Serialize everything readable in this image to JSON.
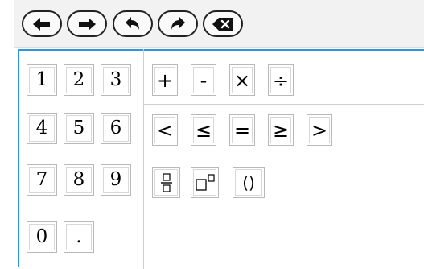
{
  "toolbar": {
    "buttons": [
      {
        "name": "back-button",
        "icon": "arrow-left-icon"
      },
      {
        "name": "forward-button",
        "icon": "arrow-right-icon"
      },
      {
        "name": "undo-button",
        "icon": "undo-icon"
      },
      {
        "name": "redo-button",
        "icon": "redo-icon"
      },
      {
        "name": "backspace-button",
        "icon": "backspace-icon"
      }
    ]
  },
  "keypad": {
    "digits": {
      "row1": [
        "1",
        "2",
        "3"
      ],
      "row2": [
        "4",
        "5",
        "6"
      ],
      "row3": [
        "7",
        "8",
        "9"
      ],
      "row4": [
        "0",
        "."
      ]
    },
    "operators": [
      "+",
      "-",
      "×",
      "÷"
    ],
    "comparisons": [
      "<",
      "≤",
      "=",
      "≥",
      ">"
    ],
    "templates": [
      {
        "name": "fraction-button",
        "icon": "fraction-icon"
      },
      {
        "name": "exponent-button",
        "icon": "exponent-icon"
      },
      {
        "name": "parentheses-button",
        "label": "()"
      }
    ]
  },
  "colors": {
    "accent": "#2f96d8",
    "toolbar_bg": "#f2f2f2",
    "key_border": "#b9b9b9"
  }
}
